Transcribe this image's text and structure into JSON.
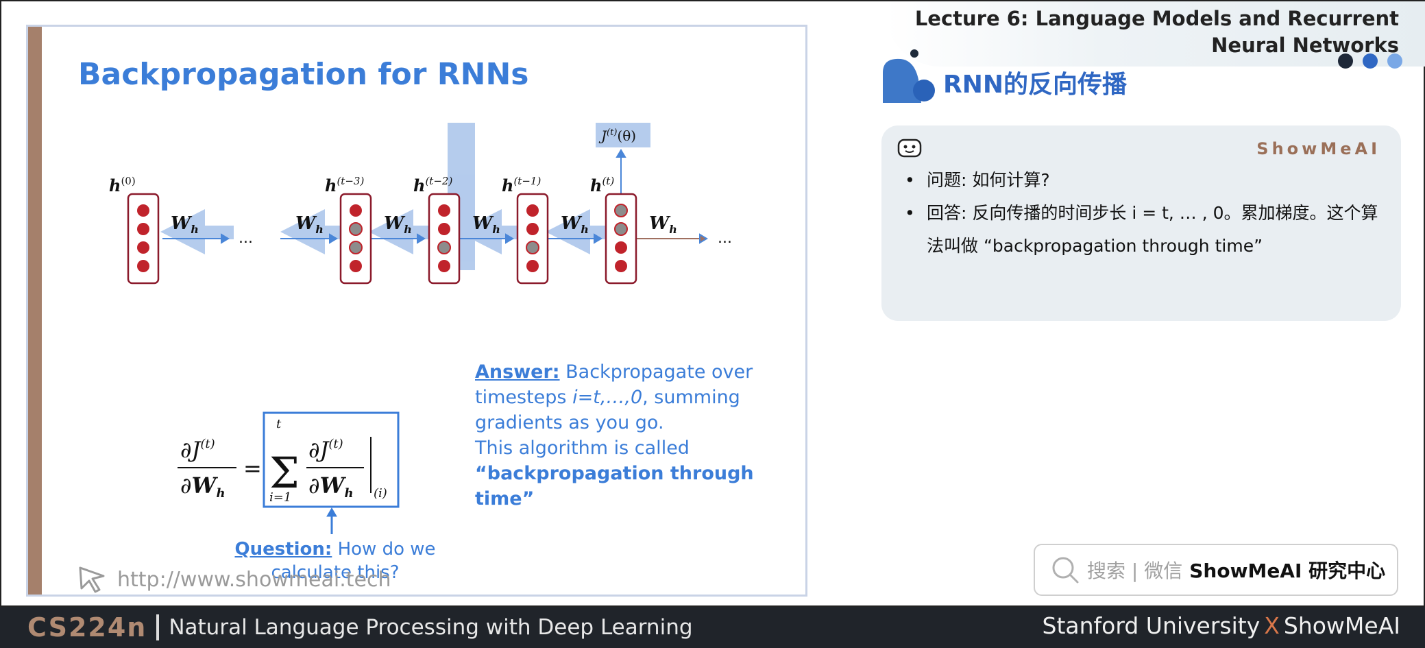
{
  "slide": {
    "title": "Backpropagation for RNNs",
    "hidden_labels": [
      "h",
      "h",
      "h",
      "h",
      "h"
    ],
    "hidden_sups": [
      "(0)",
      "(t−3)",
      "(t−2)",
      "(t−1)",
      "(t)"
    ],
    "weight_label": "W",
    "weight_sub": "h",
    "ellipsis": "...",
    "loss_label": "J",
    "loss_sup": "(t)",
    "loss_arg": "(θ)",
    "answer_head": "Answer:",
    "answer_line1": " Backpropagate over timesteps ",
    "answer_var": "i=t,…,0",
    "answer_line2": ", summing gradients as you go.",
    "answer_line3": "This algorithm is called",
    "answer_bold": "“backpropagation through time”",
    "question_head": "Question:",
    "question_body": " How do we calculate this?",
    "watermark": "http://www.showmeai.tech"
  },
  "formula": {
    "partial": "∂",
    "J": "J",
    "sup": "(t)",
    "W": "W",
    "sub": "h",
    "eq": "=",
    "sum": "Σ",
    "sum_top": "t",
    "sum_bottom": "i=1",
    "eval_sub": "(i)"
  },
  "header": {
    "lecture_title": "Lecture 6:  Language Models and Recurrent Neural Networks",
    "section_title": "RNN的反向传播"
  },
  "card": {
    "brand": "ShowMeAI",
    "bullets": [
      "问题: 如何计算?",
      "回答: 反向传播的时间步长 i = t, … , 0。累加梯度。这个算法叫做 “backpropagation through time”"
    ]
  },
  "search": {
    "hint": "搜索 | 微信",
    "brand": "ShowMeAI 研究中心"
  },
  "footer": {
    "course_code": "CS224n",
    "course_name": "Natural Language Processing with Deep Learning",
    "left_brand": "Stanford University",
    "x": "X",
    "right_brand": "ShowMeAI"
  },
  "colors": {
    "accent_blue": "#3b7dd8",
    "node_red": "#c0232b",
    "node_border": "#8b1a2b",
    "bar_brown": "#a5806b",
    "footer_bg": "#20242a"
  },
  "icons": [
    "cursor-arrow-icon",
    "robot-face-icon",
    "search-icon"
  ]
}
